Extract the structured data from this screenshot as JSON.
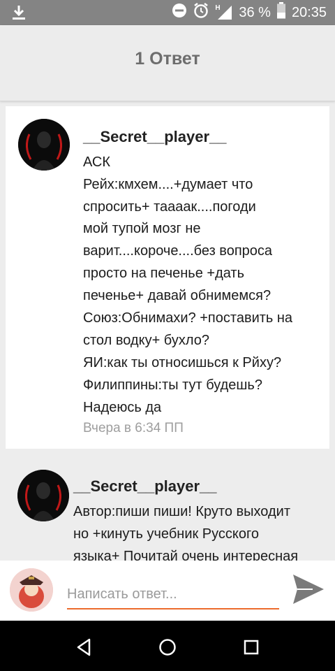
{
  "status_bar": {
    "battery_percent": "36 %",
    "network_label": "H",
    "time": "20:35",
    "icons": [
      "download-icon",
      "do-not-disturb-icon",
      "alarm-icon",
      "signal-icon",
      "battery-icon"
    ]
  },
  "header": {
    "title": "1 Ответ"
  },
  "comments": [
    {
      "username": "__Secret__player__",
      "lines": [
        "АСК",
        "Рейх:кмхем....+думает что",
        "спросить+ таааак....погоди",
        "мой тупой мозг не",
        "варит....короче....без вопроса",
        "просто на печенье +дать",
        "печенье+ давай обнимемся?",
        "Союз:Обнимахи? +поставить на",
        "стол водку+ бухло?",
        "ЯИ:как ты относишься к Рйху?",
        "Филиппины:ты тут будешь?",
        "Надеюсь да"
      ],
      "timestamp": "Вчера в 6:34 ПП"
    },
    {
      "username": "__Secret__player__",
      "lines": [
        "Автор:пиши пиши! Круто выходит",
        "но +кинуть учебник Русского",
        "языка+ Почитай очень интересная"
      ]
    }
  ],
  "reply": {
    "placeholder": "Написать ответ..."
  },
  "colors": {
    "accent": "#ec6b2d",
    "status_bar": "#848484",
    "header_bg": "#ececec",
    "timestamp": "#9e9e9e"
  }
}
